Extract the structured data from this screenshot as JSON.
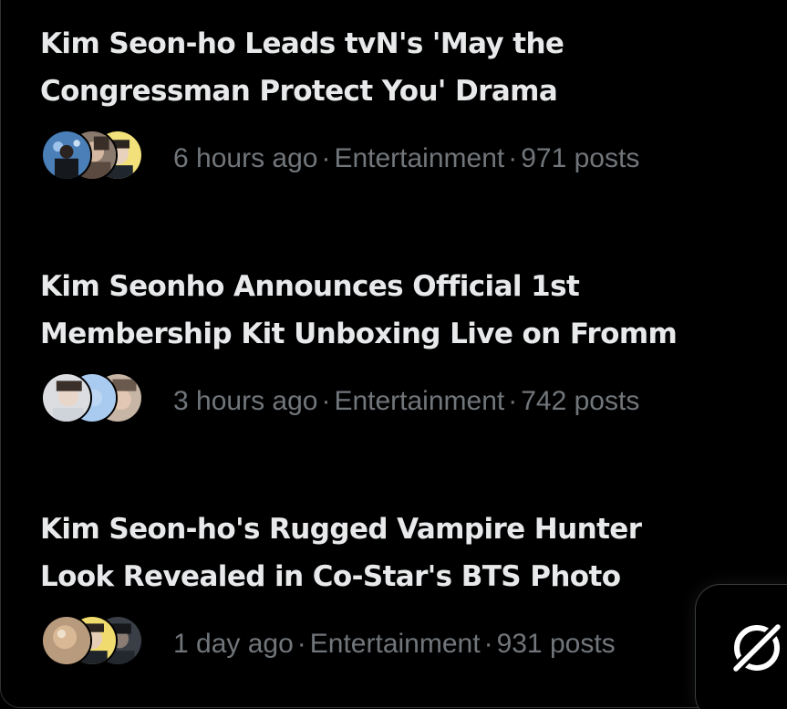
{
  "stories": [
    {
      "title": "Kim Seon-ho Leads tvN's 'May the Congressman Protect You' Drama",
      "title_line1": "Kim Seon-ho Leads tvN's 'May the",
      "title_line2": "Congressman Protect You' Drama",
      "time": "6 hours ago",
      "category": "Entertainment",
      "posts": "971 posts"
    },
    {
      "title": "Kim Seonho Announces Official 1st Membership Kit Unboxing Live on Fromm",
      "title_line1": "Kim Seonho Announces Official 1st",
      "title_line2": "Membership Kit Unboxing Live on Fromm",
      "time": "3 hours ago",
      "category": "Entertainment",
      "posts": "742 posts"
    },
    {
      "title": "Kim Seon-ho's Rugged Vampire Hunter Look Revealed in Co-Star's BTS Photo",
      "title_line1": "Kim Seon-ho's Rugged Vampire Hunter",
      "title_line2": "Look Revealed in Co-Star's BTS Photo",
      "time": "1 day ago",
      "category": "Entertainment",
      "posts": "931 posts"
    }
  ],
  "separator": "·",
  "grok_button": {
    "icon": "grok-icon"
  },
  "colors": {
    "background": "#000000",
    "headline": "#e7e9ea",
    "meta": "#71767b",
    "border": "#2f3336"
  }
}
